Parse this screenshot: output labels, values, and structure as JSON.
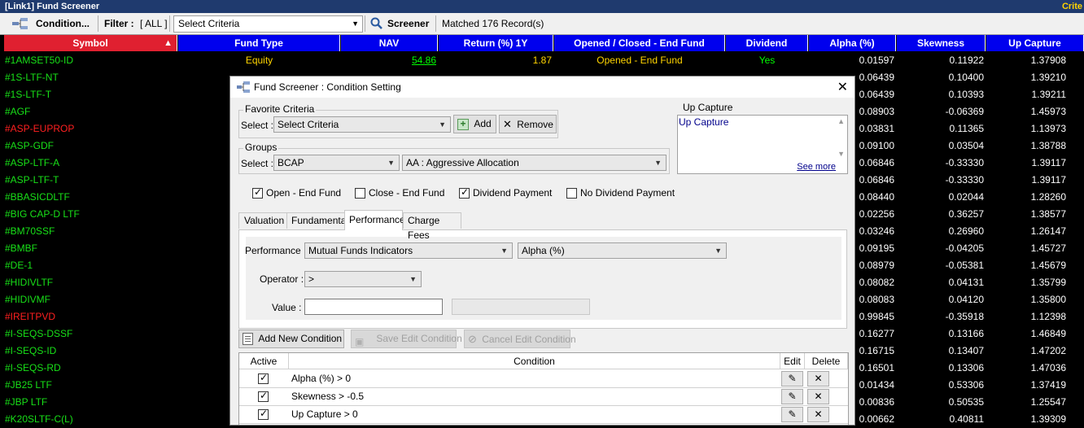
{
  "window": {
    "title": "[Link1] Fund Screener",
    "right_text": "Crite"
  },
  "toolbar": {
    "condition_label": "Condition...",
    "filter_label": "Filter :",
    "filter_value": "[ ALL ]",
    "criteria_select": "Select Criteria",
    "screener_label": "Screener",
    "matched_text": "Matched 176 Record(s)"
  },
  "grid": {
    "columns": [
      "Symbol",
      "Fund Type",
      "NAV",
      "Return (%) 1Y",
      "Opened / Closed - End Fund",
      "Dividend",
      "Alpha (%)",
      "Skewness",
      "Up Capture"
    ],
    "first_row": {
      "symbol": "#1AMSET50-ID",
      "fund_type": "Equity",
      "nav": "54.86",
      "return": "1.87",
      "open_close": "Opened - End Fund",
      "dividend": "Yes",
      "alpha": "0.01597",
      "skew": "0.11922",
      "upcap": "1.37908"
    },
    "rows": [
      {
        "symbol": "#1S-LTF-NT",
        "red": false,
        "alpha": "0.06439",
        "skew": "0.10400",
        "upcap": "1.39210"
      },
      {
        "symbol": "#1S-LTF-T",
        "red": false,
        "alpha": "0.06439",
        "skew": "0.10393",
        "upcap": "1.39211"
      },
      {
        "symbol": "#AGF",
        "red": false,
        "alpha": "0.08903",
        "skew": "-0.06369",
        "upcap": "1.45973"
      },
      {
        "symbol": "#ASP-EUPROP",
        "red": true,
        "alpha": "0.03831",
        "skew": "0.11365",
        "upcap": "1.13973"
      },
      {
        "symbol": "#ASP-GDF",
        "red": false,
        "alpha": "0.09100",
        "skew": "0.03504",
        "upcap": "1.38788"
      },
      {
        "symbol": "#ASP-LTF-A",
        "red": false,
        "alpha": "0.06846",
        "skew": "-0.33330",
        "upcap": "1.39117"
      },
      {
        "symbol": "#ASP-LTF-T",
        "red": false,
        "alpha": "0.06846",
        "skew": "-0.33330",
        "upcap": "1.39117"
      },
      {
        "symbol": "#BBASICDLTF",
        "red": false,
        "alpha": "0.08440",
        "skew": "0.02044",
        "upcap": "1.28260"
      },
      {
        "symbol": "#BIG CAP-D LTF",
        "red": false,
        "alpha": "0.02256",
        "skew": "0.36257",
        "upcap": "1.38577"
      },
      {
        "symbol": "#BM70SSF",
        "red": false,
        "alpha": "0.03246",
        "skew": "0.26960",
        "upcap": "1.26147"
      },
      {
        "symbol": "#BMBF",
        "red": false,
        "alpha": "0.09195",
        "skew": "-0.04205",
        "upcap": "1.45727"
      },
      {
        "symbol": "#DE-1",
        "red": false,
        "alpha": "0.08979",
        "skew": "-0.05381",
        "upcap": "1.45679"
      },
      {
        "symbol": "#HIDIVLTF",
        "red": false,
        "alpha": "0.08082",
        "skew": "0.04131",
        "upcap": "1.35799"
      },
      {
        "symbol": "#HIDIVMF",
        "red": false,
        "alpha": "0.08083",
        "skew": "0.04120",
        "upcap": "1.35800"
      },
      {
        "symbol": "#IREITPVD",
        "red": true,
        "alpha": "0.99845",
        "skew": "-0.35918",
        "upcap": "1.12398"
      },
      {
        "symbol": "#I-SEQS-DSSF",
        "red": false,
        "alpha": "0.16277",
        "skew": "0.13166",
        "upcap": "1.46849"
      },
      {
        "symbol": "#I-SEQS-ID",
        "red": false,
        "alpha": "0.16715",
        "skew": "0.13407",
        "upcap": "1.47202"
      },
      {
        "symbol": "#I-SEQS-RD",
        "red": false,
        "alpha": "0.16501",
        "skew": "0.13306",
        "upcap": "1.47036"
      },
      {
        "symbol": "#JB25 LTF",
        "red": false,
        "alpha": "0.01434",
        "skew": "0.53306",
        "upcap": "1.37419"
      },
      {
        "symbol": "#JBP LTF",
        "red": false,
        "alpha": "0.00836",
        "skew": "0.50535",
        "upcap": "1.25547"
      },
      {
        "symbol": "#K20SLTF-C(L)",
        "red": false,
        "alpha": "0.00662",
        "skew": "0.40811",
        "upcap": "1.39309"
      }
    ]
  },
  "dialog": {
    "title": "Fund Screener : Condition Setting",
    "favorite": {
      "legend": "Favorite Criteria",
      "select_label": "Select :",
      "value": "Select Criteria",
      "add": "Add",
      "remove": "Remove"
    },
    "groups": {
      "legend": "Groups",
      "select_label": "Select :",
      "value1": "BCAP",
      "value2": "AA : Aggressive Allocation"
    },
    "upcapture": {
      "legend": "Up Capture",
      "text": "Up Capture",
      "see_more": "See more"
    },
    "checks": [
      {
        "label": "Open - End Fund",
        "checked": true
      },
      {
        "label": "Close - End Fund",
        "checked": false
      },
      {
        "label": "Dividend Payment",
        "checked": true
      },
      {
        "label": "No Dividend Payment",
        "checked": false
      }
    ],
    "tabs": [
      "Valuation",
      "Fundamental",
      "Performance",
      "Charge Fees"
    ],
    "performance": {
      "label": "Performance :",
      "value1": "Mutual Funds Indicators",
      "value2": "Alpha (%)"
    },
    "operator": {
      "label": "Operator :",
      "value": ">"
    },
    "value": {
      "label": "Value :",
      "value": ""
    },
    "buttons": {
      "add": "Add New Condition",
      "save": "Save Edit Condition",
      "cancel": "Cancel Edit Condition"
    },
    "table": {
      "headers": [
        "Active",
        "Condition",
        "Edit",
        "Delete"
      ],
      "rows": [
        {
          "active": true,
          "condition": "Alpha (%) > 0"
        },
        {
          "active": true,
          "condition": "Skewness > -0.5"
        },
        {
          "active": true,
          "condition": "Up Capture > 0"
        }
      ]
    }
  }
}
